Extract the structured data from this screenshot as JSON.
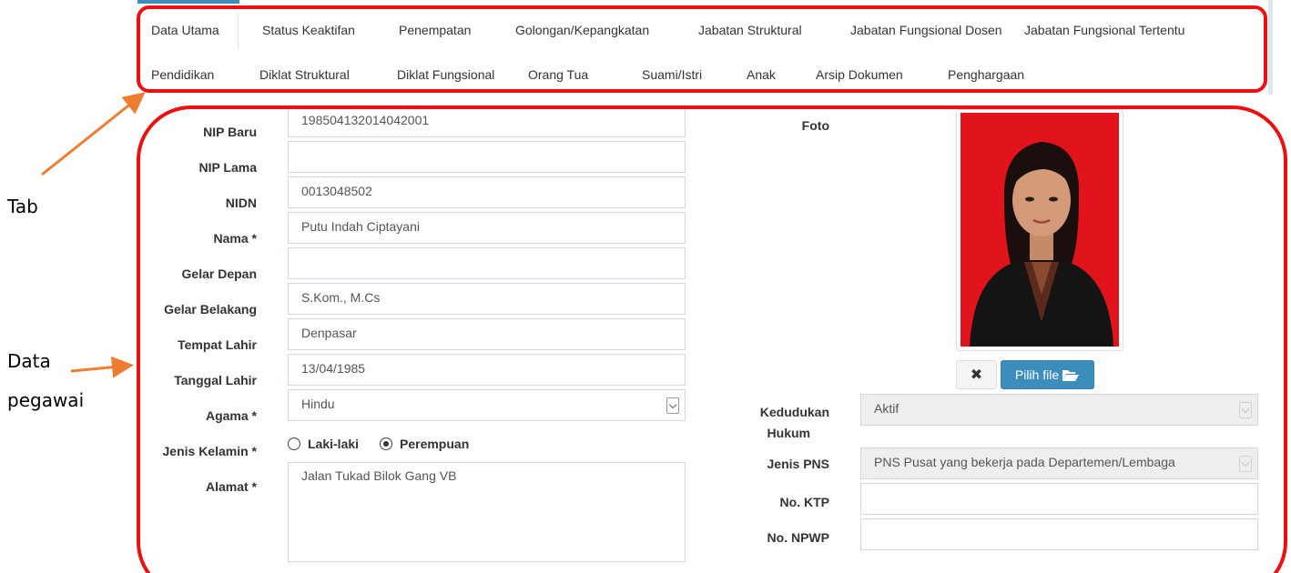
{
  "tabs": {
    "row1": [
      "Data Utama",
      "Status Keaktifan",
      "Penempatan",
      "Golongan/Kepangkatan",
      "Jabatan Struktural",
      "Jabatan Fungsional Dosen",
      "Jabatan Fungsional Tertentu"
    ],
    "row2": [
      "Pendidikan",
      "Diklat Struktural",
      "Diklat Fungsional",
      "Orang Tua",
      "Suami/Istri",
      "Anak",
      "Arsip Dokumen",
      "Penghargaan"
    ],
    "active": "Data Utama"
  },
  "annotations": {
    "tab": "Tab",
    "data_line1": "Data",
    "data_line2": "pegawai"
  },
  "form": {
    "nip_baru": {
      "label": "NIP Baru",
      "value": "198504132014042001"
    },
    "nip_lama": {
      "label": "NIP Lama",
      "value": ""
    },
    "nidn": {
      "label": "NIDN",
      "value": "0013048502"
    },
    "nama": {
      "label": "Nama *",
      "value": "Putu Indah Ciptayani"
    },
    "gelar_depan": {
      "label": "Gelar Depan",
      "value": ""
    },
    "gelar_belakang": {
      "label": "Gelar Belakang",
      "value": "S.Kom., M.Cs"
    },
    "tempat_lahir": {
      "label": "Tempat Lahir",
      "value": "Denpasar"
    },
    "tanggal_lahir": {
      "label": "Tanggal Lahir",
      "value": "13/04/1985"
    },
    "agama": {
      "label": "Agama *",
      "value": "Hindu"
    },
    "jenis_kelamin": {
      "label": "Jenis Kelamin *",
      "options": [
        "Laki-laki",
        "Perempuan"
      ],
      "selected": "Perempuan"
    },
    "alamat": {
      "label": "Alamat *",
      "value": "Jalan Tukad Bilok Gang VB"
    },
    "foto": {
      "label": "Foto"
    },
    "pilih_file": "Pilih file",
    "kedudukan_hukum": {
      "label_line1": "Kedudukan",
      "label_line2": "Hukum",
      "value": "Aktif"
    },
    "jenis_pns": {
      "label": "Jenis PNS",
      "value": "PNS Pusat yang bekerja pada Departemen/Lembaga"
    },
    "no_ktp": {
      "label": "No. KTP",
      "value": ""
    },
    "no_npwp": {
      "label": "No. NPWP",
      "value": ""
    }
  },
  "colors": {
    "annotation_red": "#ee1010",
    "arrow_orange": "#ed7d31",
    "primary_button": "#3c8dbc",
    "photo_background": "#e0141a"
  }
}
